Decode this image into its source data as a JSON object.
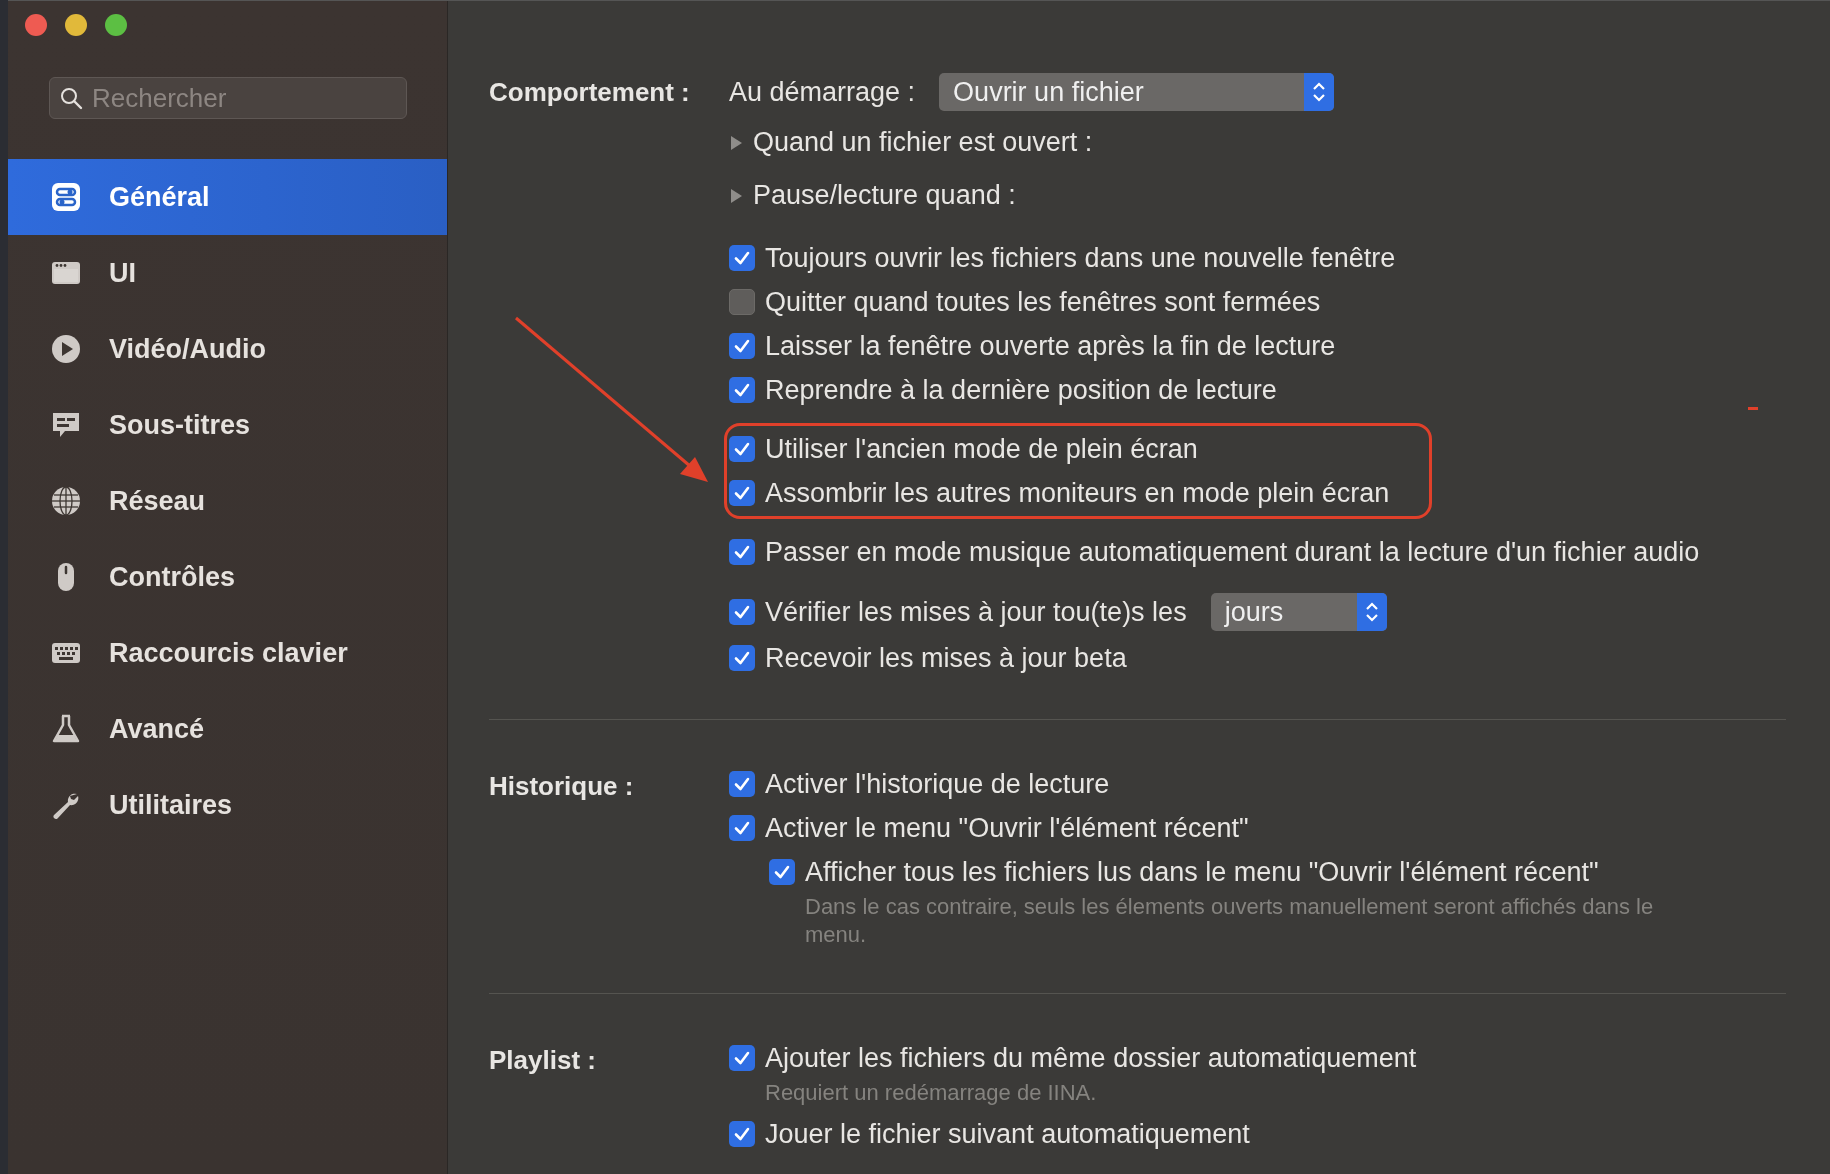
{
  "sidebar": {
    "search": {
      "placeholder": "Rechercher"
    },
    "items": [
      {
        "label": "Général",
        "selected": true
      },
      {
        "label": "UI",
        "selected": false
      },
      {
        "label": "Vidéo/Audio",
        "selected": false
      },
      {
        "label": "Sous-titres",
        "selected": false
      },
      {
        "label": "Réseau",
        "selected": false
      },
      {
        "label": "Contrôles",
        "selected": false
      },
      {
        "label": "Raccourcis clavier",
        "selected": false
      },
      {
        "label": "Avancé",
        "selected": false
      },
      {
        "label": "Utilitaires",
        "selected": false
      }
    ]
  },
  "sections": [
    {
      "label": "Comportement :",
      "groups": [
        {
          "highlighted": false,
          "rows": [
            {
              "kind": "popup",
              "label": "Au démarrage :",
              "value": "Ouvrir un fichier"
            },
            {
              "kind": "disclosure",
              "label": "Quand un fichier est ouvert :",
              "expanded": false
            },
            {
              "kind": "disclosure",
              "label": "Pause/lecture quand :",
              "expanded": false
            }
          ]
        },
        {
          "highlighted": false,
          "rows": [
            {
              "kind": "checkbox",
              "label": "Toujours ouvrir les fichiers dans une nouvelle fenêtre",
              "checked": true
            },
            {
              "kind": "checkbox",
              "label": "Quitter quand toutes les fenêtres sont fermées",
              "checked": false
            },
            {
              "kind": "checkbox",
              "label": "Laisser la fenêtre ouverte après la fin de lecture",
              "checked": true
            },
            {
              "kind": "checkbox",
              "label": "Reprendre à la dernière position de lecture",
              "checked": true
            }
          ]
        },
        {
          "highlighted": true,
          "rows": [
            {
              "kind": "checkbox",
              "label": "Utiliser l'ancien mode de plein écran",
              "checked": true
            },
            {
              "kind": "checkbox",
              "label": "Assombrir les autres moniteurs en mode plein écran",
              "checked": true
            }
          ]
        },
        {
          "highlighted": false,
          "rows": [
            {
              "kind": "checkbox",
              "label": "Passer en mode musique automatiquement durant la lecture d'un fichier audio",
              "checked": true
            }
          ]
        },
        {
          "highlighted": false,
          "rows": [
            {
              "kind": "checkbox_popup",
              "label": "Vérifier les mises à jour tou(te)s les",
              "checked": true,
              "value": "jours"
            },
            {
              "kind": "checkbox",
              "label": "Recevoir les mises à jour beta",
              "checked": true
            }
          ]
        }
      ]
    },
    {
      "label": "Historique :",
      "groups": [
        {
          "highlighted": false,
          "rows": [
            {
              "kind": "checkbox",
              "label": "Activer l'historique de lecture",
              "checked": true
            },
            {
              "kind": "checkbox",
              "label": "Activer le menu \"Ouvrir l'élément récent\"",
              "checked": true,
              "children": [
                {
                  "kind": "checkbox",
                  "label": "Afficher tous les fichiers lus dans le menu \"Ouvrir l'élément récent\"",
                  "checked": true,
                  "note": "Dans le cas contraire, seuls les élements ouverts manuellement seront affichés dans le menu."
                }
              ]
            }
          ]
        }
      ]
    },
    {
      "label": "Playlist :",
      "groups": [
        {
          "highlighted": false,
          "rows": [
            {
              "kind": "checkbox",
              "label": "Ajouter les fichiers du même dossier automatiquement",
              "checked": true,
              "note": "Requiert un redémarrage de IINA."
            },
            {
              "kind": "checkbox",
              "label": "Jouer le fichier suivant automatiquement",
              "checked": true
            }
          ]
        }
      ]
    }
  ]
}
